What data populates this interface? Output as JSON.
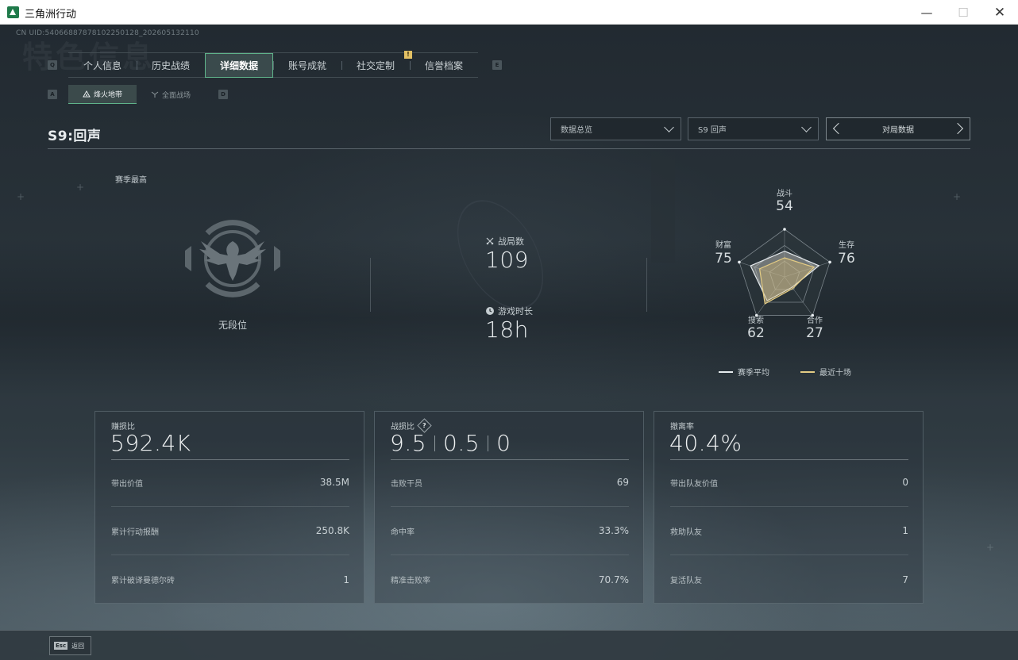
{
  "window": {
    "title": "三角洲行动",
    "minimize": "—",
    "maximize": "☐",
    "close": "✕"
  },
  "uid": "CN UID:540668878781022501​28_202605132110",
  "bg_title": "特色信息",
  "keyhints": {
    "prev_tab": "Q",
    "next_tab": "E",
    "prev_sub": "A",
    "next_sub": "D"
  },
  "tabs": [
    {
      "label": "个人信息",
      "active": false
    },
    {
      "label": "历史战绩",
      "active": false
    },
    {
      "label": "详细数据",
      "active": true
    },
    {
      "label": "账号成就",
      "active": false
    },
    {
      "label": "社交定制",
      "active": false
    },
    {
      "label": "信誉档案",
      "active": false
    }
  ],
  "notice_badge": "!",
  "subtabs": [
    {
      "label": "烽火地带",
      "icon": "beacon-icon",
      "active": true
    },
    {
      "label": "全面战场",
      "icon": "battlefield-icon",
      "active": false
    }
  ],
  "season_title": "S9:回声",
  "filters": {
    "mode": "数据总览",
    "season": "S9 回声",
    "view": "对局数据"
  },
  "overview": {
    "season_best_label": "赛季最高",
    "rank": "无段位",
    "matches_label": "战局数",
    "matches": "109",
    "playtime_label": "游戏时长",
    "playtime": "18h"
  },
  "radar": {
    "axes": [
      {
        "label": "战斗",
        "value": "54"
      },
      {
        "label": "生存",
        "value": "76"
      },
      {
        "label": "合作",
        "value": "27"
      },
      {
        "label": "搜索",
        "value": "62"
      },
      {
        "label": "财富",
        "value": "75"
      }
    ],
    "season_avg": [
      54,
      76,
      27,
      62,
      75
    ],
    "recent_ten": [
      40,
      65,
      30,
      70,
      55
    ],
    "legend_avg": "赛季平均",
    "legend_recent": "最近十场",
    "colors": {
      "avg": "#e6ebee",
      "recent": "#e4cc84"
    }
  },
  "cards": {
    "profit": {
      "label": "赚损比",
      "value": "592.4K",
      "rows": [
        {
          "label": "带出价值",
          "value": "38.5M"
        },
        {
          "label": "累计行动报酬",
          "value": "250.8K"
        },
        {
          "label": "累计破译曼德尔砖",
          "value": "1"
        }
      ]
    },
    "combat": {
      "label": "战损比",
      "help": "?",
      "values": [
        "9.5",
        "0.5",
        "0"
      ],
      "rows": [
        {
          "label": "击败干员",
          "value": "69"
        },
        {
          "label": "命中率",
          "value": "33.3%"
        },
        {
          "label": "精准击败率",
          "value": "70.7%"
        }
      ]
    },
    "extract": {
      "label": "撤离率",
      "value": "40.4%",
      "rows": [
        {
          "label": "带出队友价值",
          "value": "0"
        },
        {
          "label": "救助队友",
          "value": "1"
        },
        {
          "label": "复活队友",
          "value": "7"
        }
      ]
    }
  },
  "footer": {
    "esc_key": "Esc",
    "esc_label": "返回"
  }
}
